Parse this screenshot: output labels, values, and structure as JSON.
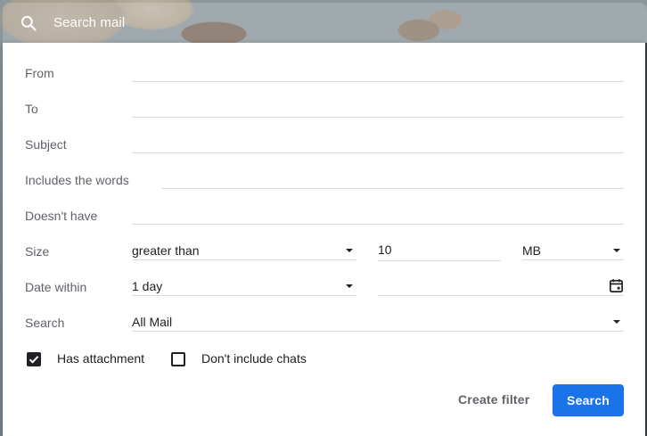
{
  "search_bar": {
    "placeholder": "Search mail",
    "icon": "search-icon"
  },
  "form": {
    "from": {
      "label": "From",
      "value": ""
    },
    "to": {
      "label": "To",
      "value": ""
    },
    "subject": {
      "label": "Subject",
      "value": ""
    },
    "includes_words": {
      "label": "Includes the words",
      "value": ""
    },
    "doesnt_have": {
      "label": "Doesn't have",
      "value": ""
    },
    "size": {
      "label": "Size",
      "comparator": "greater than",
      "value": "10",
      "unit": "MB"
    },
    "date_within": {
      "label": "Date within",
      "value": "1 day",
      "date": "",
      "icon": "calendar-icon"
    },
    "search_in": {
      "label": "Search",
      "value": "All Mail"
    },
    "has_attachment": {
      "label": "Has attachment",
      "checked": true
    },
    "dont_include_chats": {
      "label": "Don't include chats",
      "checked": false
    }
  },
  "actions": {
    "create_filter": "Create filter",
    "search": "Search"
  },
  "colors": {
    "primary": "#1a73e8",
    "label": "#5f6368",
    "divider": "#dadce0"
  }
}
